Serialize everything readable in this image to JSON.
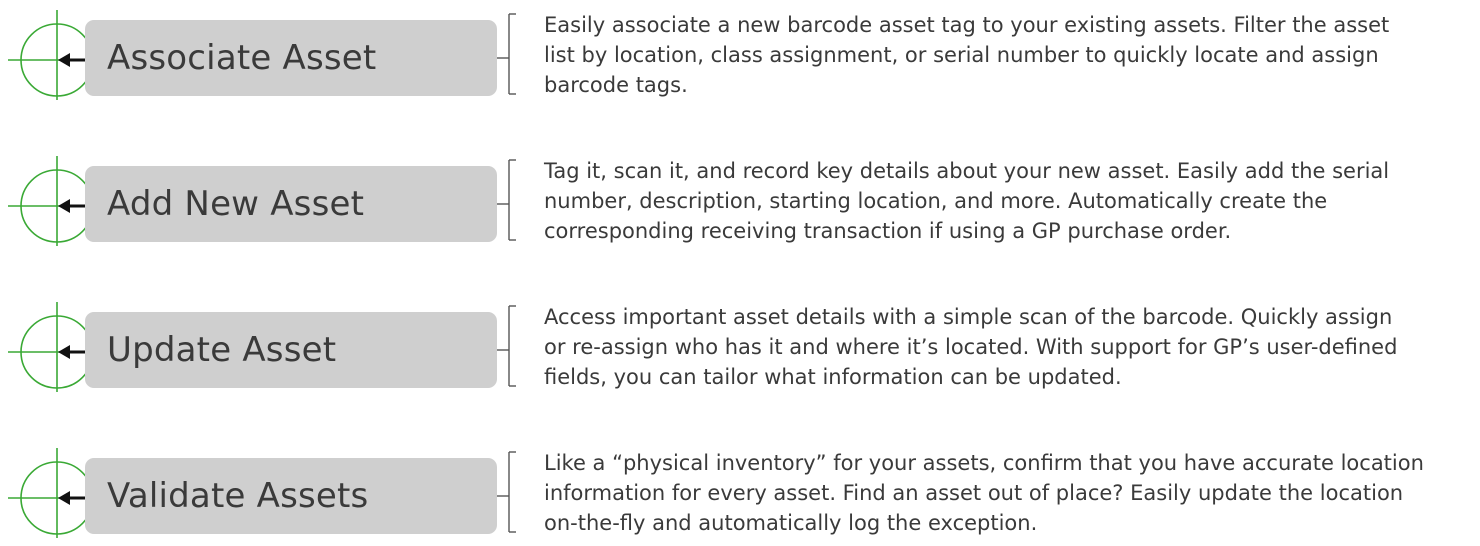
{
  "colors": {
    "crosshair": "#3aa935",
    "pill_background": "#cfcfcf",
    "text": "#3a3a3a",
    "connector": "#555555"
  },
  "icons": {
    "row_marker": "crosshair-arrow-icon"
  },
  "features": [
    {
      "title": "Associate Asset",
      "description_lines": [
        "Easily associate a new barcode asset tag to your existing assets. Filter the asset",
        "list by location, class assignment, or serial number to quickly locate and assign",
        "barcode tags."
      ]
    },
    {
      "title": "Add New Asset",
      "description_lines": [
        "Tag it, scan it, and record key details about your new asset. Easily add the serial",
        "number, description, starting location, and more. Automatically create the",
        "corresponding receiving transaction if using a GP purchase order."
      ]
    },
    {
      "title": "Update Asset",
      "description_lines": [
        "Access important asset details with a simple scan of the barcode. Quickly assign",
        "or re-assign who has it and where it’s located. With support for GP’s user-defined",
        "fields, you can tailor what information can be updated."
      ]
    },
    {
      "title": "Validate Assets",
      "description_lines": [
        "Like a “physical inventory” for your assets, confirm that you have accurate location",
        "information for every asset. Find an asset out of place? Easily update the location",
        "on-the-fly and automatically log the exception."
      ]
    }
  ]
}
